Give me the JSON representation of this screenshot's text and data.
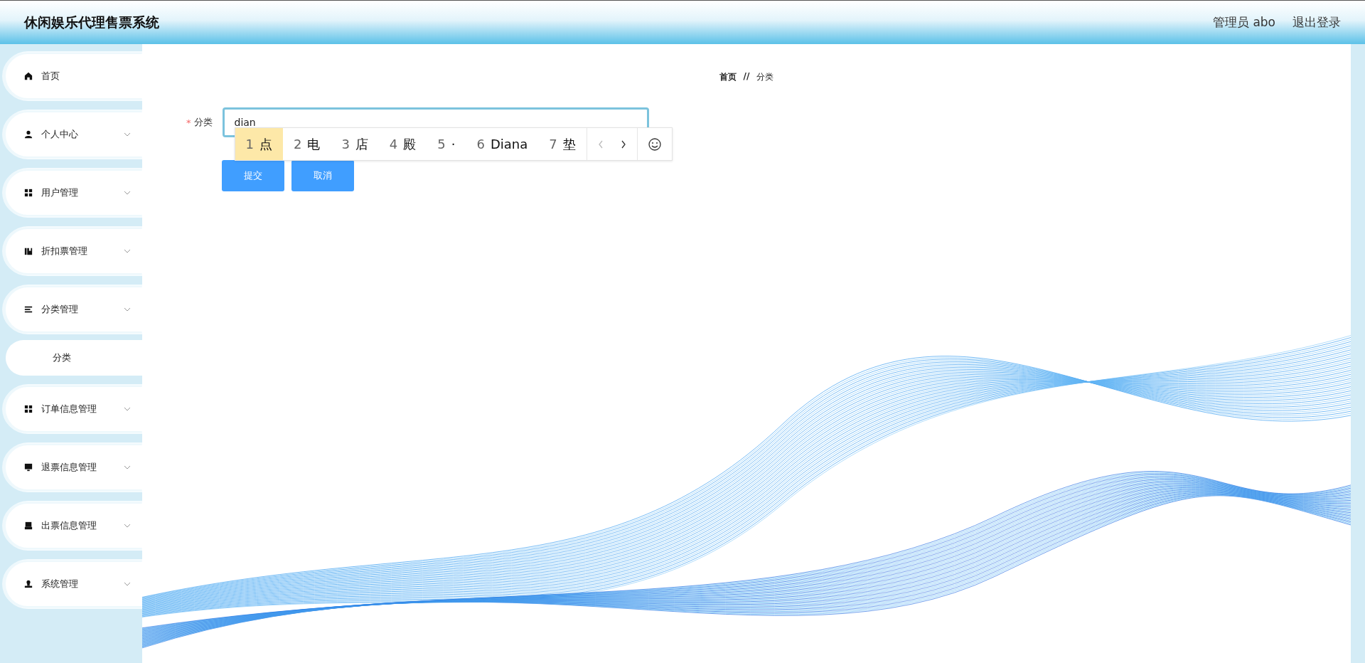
{
  "header": {
    "title": "休闲娱乐代理售票系统",
    "user": "管理员 abo",
    "logout": "退出登录"
  },
  "sidebar": {
    "items": [
      {
        "label": "首页",
        "expandable": false
      },
      {
        "label": "个人中心",
        "expandable": true
      },
      {
        "label": "用户管理",
        "expandable": true
      },
      {
        "label": "折扣票管理",
        "expandable": true
      },
      {
        "label": "分类管理",
        "expandable": true,
        "children": [
          {
            "label": "分类"
          }
        ]
      },
      {
        "label": "订单信息管理",
        "expandable": true
      },
      {
        "label": "退票信息管理",
        "expandable": true
      },
      {
        "label": "出票信息管理",
        "expandable": true
      },
      {
        "label": "系统管理",
        "expandable": true
      }
    ]
  },
  "breadcrumb": {
    "items": [
      "首页",
      "分类"
    ],
    "separator": "//"
  },
  "form": {
    "fields": [
      {
        "label": "分类",
        "required_mark": "*",
        "value": "dian"
      }
    ],
    "buttons": [
      "提交",
      "取消"
    ]
  },
  "ime": {
    "candidates": [
      {
        "number": "1",
        "text": "点",
        "selected": true
      },
      {
        "number": "2",
        "text": "电",
        "selected": false
      },
      {
        "number": "3",
        "text": "店",
        "selected": false
      },
      {
        "number": "4",
        "text": "殿",
        "selected": false
      },
      {
        "number": "5",
        "text": "·",
        "selected": false
      },
      {
        "number": "6",
        "text": "Diana",
        "selected": false
      },
      {
        "number": "7",
        "text": "垫",
        "selected": false
      }
    ]
  }
}
